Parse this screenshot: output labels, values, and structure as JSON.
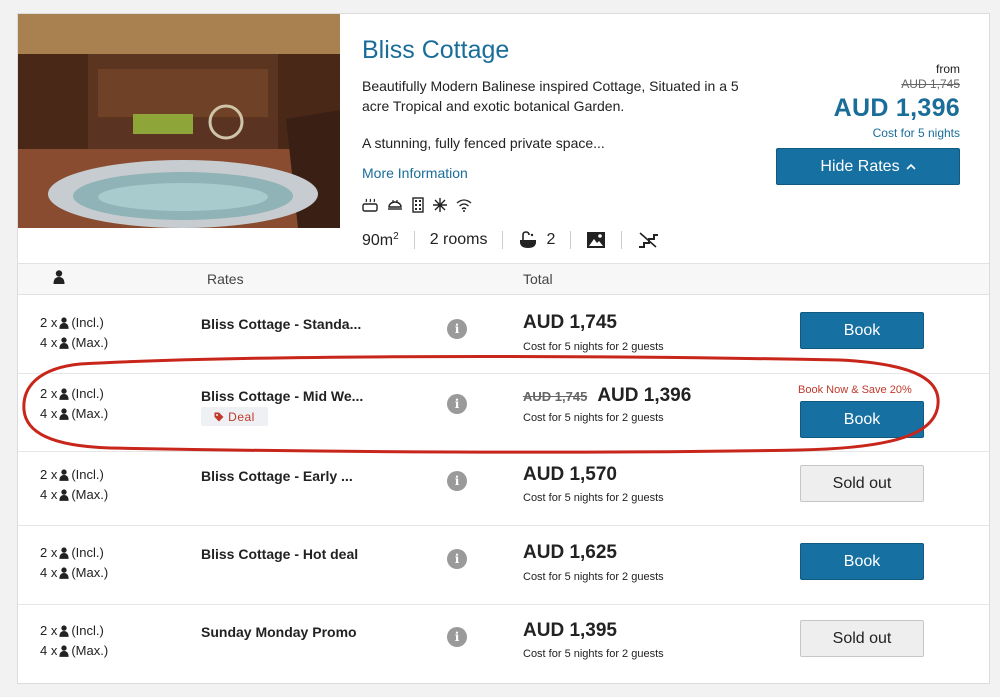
{
  "property": {
    "title": "Bliss Cottage",
    "description": "Beautifully Modern Balinese inspired Cottage, Situated in a 5 acre Tropical and exotic botanical Garden.",
    "teaser": "A stunning, fully fenced private space...",
    "more_info": "More Information",
    "amenity_icons": [
      "hot-tub-icon",
      "bbq-icon",
      "building-icon",
      "snowflake-icon",
      "wifi-icon"
    ],
    "stats": {
      "area": "90m",
      "area_sup": "2",
      "rooms": "2 rooms",
      "bathrooms": "2"
    }
  },
  "pricebox": {
    "from": "from",
    "old_price": "AUD 1,745",
    "price": "AUD 1,396",
    "cost": "Cost for 5 nights",
    "hide_button": "Hide Rates",
    "hide_icon": "chevron-up-icon"
  },
  "table": {
    "headers": {
      "rates": "Rates",
      "total": "Total"
    },
    "rows": [
      {
        "incl": "2 x",
        "incl_label": "(Incl.)",
        "max": "4 x",
        "max_label": "(Max.)",
        "name": "Bliss Cottage - Standa...",
        "old_price": "",
        "price": "AUD 1,745",
        "cost": "Cost for 5 nights for 2 guests",
        "action": "Book"
      },
      {
        "incl": "2 x",
        "incl_label": "(Incl.)",
        "max": "4 x",
        "max_label": "(Max.)",
        "name": "Bliss Cottage - Mid We...",
        "deal": "Deal",
        "old_price": "AUD 1,745",
        "price": "AUD 1,396",
        "cost": "Cost for 5 nights for 2 guests",
        "promo": "Book Now & Save 20%",
        "action": "Book"
      },
      {
        "incl": "2 x",
        "incl_label": "(Incl.)",
        "max": "4 x",
        "max_label": "(Max.)",
        "name": "Bliss Cottage - Early ...",
        "old_price": "",
        "price": "AUD 1,570",
        "cost": "Cost for 5 nights for 2 guests",
        "action": "Sold out"
      },
      {
        "incl": "2 x",
        "incl_label": "(Incl.)",
        "max": "4 x",
        "max_label": "(Max.)",
        "name": "Bliss Cottage - Hot deal",
        "old_price": "",
        "price": "AUD 1,625",
        "cost": "Cost for 5 nights for 2 guests",
        "action": "Book"
      },
      {
        "incl": "2 x",
        "incl_label": "(Incl.)",
        "max": "4 x",
        "max_label": "(Max.)",
        "name": "Sunday Monday Promo",
        "old_price": "",
        "price": "AUD 1,395",
        "cost": "Cost for 5 nights for 2 guests",
        "action": "Sold out"
      }
    ]
  },
  "colors": {
    "accent": "#1a6d99",
    "button": "#1670a1",
    "promo": "#c0392b",
    "annotation": "#c8261b"
  }
}
